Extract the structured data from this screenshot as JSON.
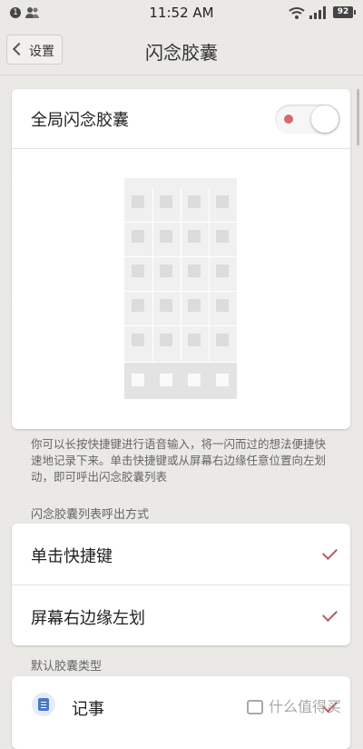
{
  "status_bar": {
    "notification_count": "1",
    "time": "11:52 AM",
    "battery": "92"
  },
  "header": {
    "back_label": "设置",
    "title": "闪念胶囊"
  },
  "global_toggle": {
    "label": "全局闪念胶囊",
    "enabled": true
  },
  "description": "你可以长按快捷键进行语音输入，将一闪而过的想法便捷快速地记录下来。单击快捷键或从屏幕右边缘任意位置向左划动，即可呼出闪念胶囊列表",
  "invoke_section": {
    "header": "闪念胶囊列表呼出方式",
    "options": [
      {
        "label": "单击快捷键",
        "checked": true
      },
      {
        "label": "屏幕右边缘左划",
        "checked": true
      }
    ]
  },
  "default_type_section": {
    "header": "默认胶囊类型",
    "options": [
      {
        "label": "记事",
        "icon": "note-icon"
      }
    ]
  },
  "watermark": "什么值得买",
  "colors": {
    "accent_red": "#d46a6a",
    "check_red": "#b55c5c",
    "background": "#ecebe8"
  }
}
